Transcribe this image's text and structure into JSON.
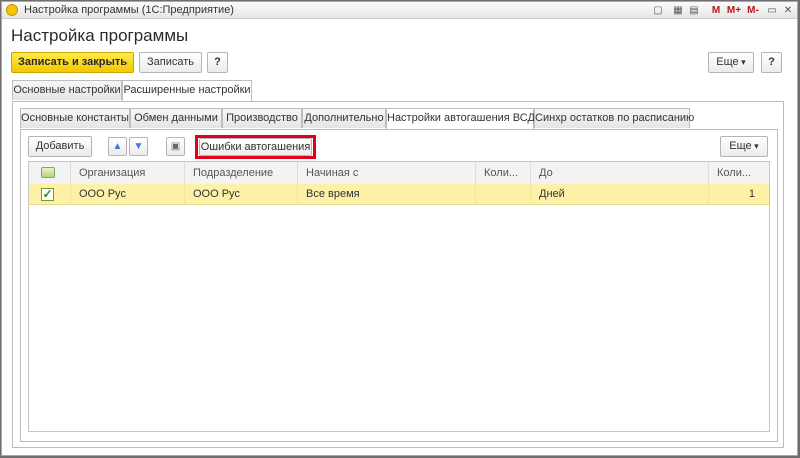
{
  "window": {
    "title": "Настройка программы (1С:Предприятие)",
    "toolbar_m": "M",
    "toolbar_mplus": "M+",
    "toolbar_mminus": "M-",
    "toolbar_restore": "▭",
    "toolbar_close": "✕"
  },
  "header": {
    "title": "Настройка программы"
  },
  "commandbar": {
    "save_close": "Записать и закрыть",
    "save": "Записать",
    "help": "?",
    "more": "Еще",
    "help2": "?"
  },
  "outer_tabs": [
    "Основные настройки",
    "Расширенные настройки"
  ],
  "inner_tabs": [
    "Основные константы",
    "Обмен данными",
    "Производство",
    "Дополнительно",
    "Настройки автогашения ВСД",
    "Синхр остатков по расписанию"
  ],
  "subbar": {
    "add": "Добавить",
    "errors": "Ошибки автогашения",
    "more": "Еще"
  },
  "table": {
    "columns": [
      "Организация",
      "Подразделение",
      "Начиная с",
      "Коли...",
      "До",
      "Коли..."
    ],
    "rows": [
      {
        "checked": true,
        "org": "ООО Рус",
        "dept": "ООО Рус",
        "from": "Все время",
        "qty1": "",
        "to": "Дней",
        "qty2": "1"
      }
    ]
  },
  "colors": {
    "accent": "#f2c800",
    "highlight": "#e0001b",
    "selected_row": "#fdf1a8"
  }
}
